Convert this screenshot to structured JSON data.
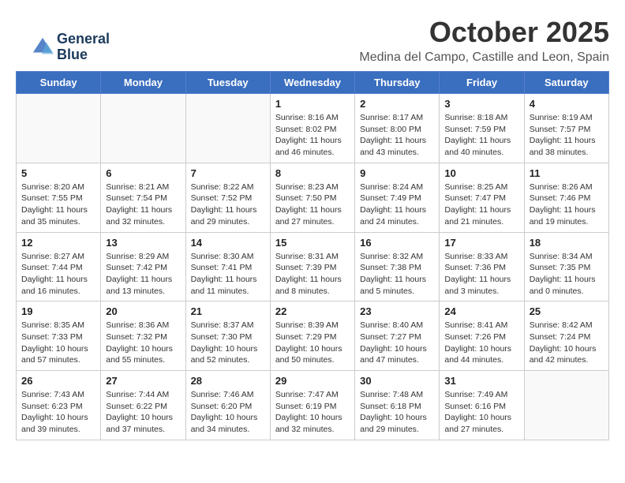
{
  "logo": {
    "line1": "General",
    "line2": "Blue"
  },
  "header": {
    "month_year": "October 2025",
    "location": "Medina del Campo, Castille and Leon, Spain"
  },
  "weekdays": [
    "Sunday",
    "Monday",
    "Tuesday",
    "Wednesday",
    "Thursday",
    "Friday",
    "Saturday"
  ],
  "weeks": [
    [
      {
        "day": "",
        "info": ""
      },
      {
        "day": "",
        "info": ""
      },
      {
        "day": "",
        "info": ""
      },
      {
        "day": "1",
        "info": "Sunrise: 8:16 AM\nSunset: 8:02 PM\nDaylight: 11 hours\nand 46 minutes."
      },
      {
        "day": "2",
        "info": "Sunrise: 8:17 AM\nSunset: 8:00 PM\nDaylight: 11 hours\nand 43 minutes."
      },
      {
        "day": "3",
        "info": "Sunrise: 8:18 AM\nSunset: 7:59 PM\nDaylight: 11 hours\nand 40 minutes."
      },
      {
        "day": "4",
        "info": "Sunrise: 8:19 AM\nSunset: 7:57 PM\nDaylight: 11 hours\nand 38 minutes."
      }
    ],
    [
      {
        "day": "5",
        "info": "Sunrise: 8:20 AM\nSunset: 7:55 PM\nDaylight: 11 hours\nand 35 minutes."
      },
      {
        "day": "6",
        "info": "Sunrise: 8:21 AM\nSunset: 7:54 PM\nDaylight: 11 hours\nand 32 minutes."
      },
      {
        "day": "7",
        "info": "Sunrise: 8:22 AM\nSunset: 7:52 PM\nDaylight: 11 hours\nand 29 minutes."
      },
      {
        "day": "8",
        "info": "Sunrise: 8:23 AM\nSunset: 7:50 PM\nDaylight: 11 hours\nand 27 minutes."
      },
      {
        "day": "9",
        "info": "Sunrise: 8:24 AM\nSunset: 7:49 PM\nDaylight: 11 hours\nand 24 minutes."
      },
      {
        "day": "10",
        "info": "Sunrise: 8:25 AM\nSunset: 7:47 PM\nDaylight: 11 hours\nand 21 minutes."
      },
      {
        "day": "11",
        "info": "Sunrise: 8:26 AM\nSunset: 7:46 PM\nDaylight: 11 hours\nand 19 minutes."
      }
    ],
    [
      {
        "day": "12",
        "info": "Sunrise: 8:27 AM\nSunset: 7:44 PM\nDaylight: 11 hours\nand 16 minutes."
      },
      {
        "day": "13",
        "info": "Sunrise: 8:29 AM\nSunset: 7:42 PM\nDaylight: 11 hours\nand 13 minutes."
      },
      {
        "day": "14",
        "info": "Sunrise: 8:30 AM\nSunset: 7:41 PM\nDaylight: 11 hours\nand 11 minutes."
      },
      {
        "day": "15",
        "info": "Sunrise: 8:31 AM\nSunset: 7:39 PM\nDaylight: 11 hours\nand 8 minutes."
      },
      {
        "day": "16",
        "info": "Sunrise: 8:32 AM\nSunset: 7:38 PM\nDaylight: 11 hours\nand 5 minutes."
      },
      {
        "day": "17",
        "info": "Sunrise: 8:33 AM\nSunset: 7:36 PM\nDaylight: 11 hours\nand 3 minutes."
      },
      {
        "day": "18",
        "info": "Sunrise: 8:34 AM\nSunset: 7:35 PM\nDaylight: 11 hours\nand 0 minutes."
      }
    ],
    [
      {
        "day": "19",
        "info": "Sunrise: 8:35 AM\nSunset: 7:33 PM\nDaylight: 10 hours\nand 57 minutes."
      },
      {
        "day": "20",
        "info": "Sunrise: 8:36 AM\nSunset: 7:32 PM\nDaylight: 10 hours\nand 55 minutes."
      },
      {
        "day": "21",
        "info": "Sunrise: 8:37 AM\nSunset: 7:30 PM\nDaylight: 10 hours\nand 52 minutes."
      },
      {
        "day": "22",
        "info": "Sunrise: 8:39 AM\nSunset: 7:29 PM\nDaylight: 10 hours\nand 50 minutes."
      },
      {
        "day": "23",
        "info": "Sunrise: 8:40 AM\nSunset: 7:27 PM\nDaylight: 10 hours\nand 47 minutes."
      },
      {
        "day": "24",
        "info": "Sunrise: 8:41 AM\nSunset: 7:26 PM\nDaylight: 10 hours\nand 44 minutes."
      },
      {
        "day": "25",
        "info": "Sunrise: 8:42 AM\nSunset: 7:24 PM\nDaylight: 10 hours\nand 42 minutes."
      }
    ],
    [
      {
        "day": "26",
        "info": "Sunrise: 7:43 AM\nSunset: 6:23 PM\nDaylight: 10 hours\nand 39 minutes."
      },
      {
        "day": "27",
        "info": "Sunrise: 7:44 AM\nSunset: 6:22 PM\nDaylight: 10 hours\nand 37 minutes."
      },
      {
        "day": "28",
        "info": "Sunrise: 7:46 AM\nSunset: 6:20 PM\nDaylight: 10 hours\nand 34 minutes."
      },
      {
        "day": "29",
        "info": "Sunrise: 7:47 AM\nSunset: 6:19 PM\nDaylight: 10 hours\nand 32 minutes."
      },
      {
        "day": "30",
        "info": "Sunrise: 7:48 AM\nSunset: 6:18 PM\nDaylight: 10 hours\nand 29 minutes."
      },
      {
        "day": "31",
        "info": "Sunrise: 7:49 AM\nSunset: 6:16 PM\nDaylight: 10 hours\nand 27 minutes."
      },
      {
        "day": "",
        "info": ""
      }
    ]
  ]
}
